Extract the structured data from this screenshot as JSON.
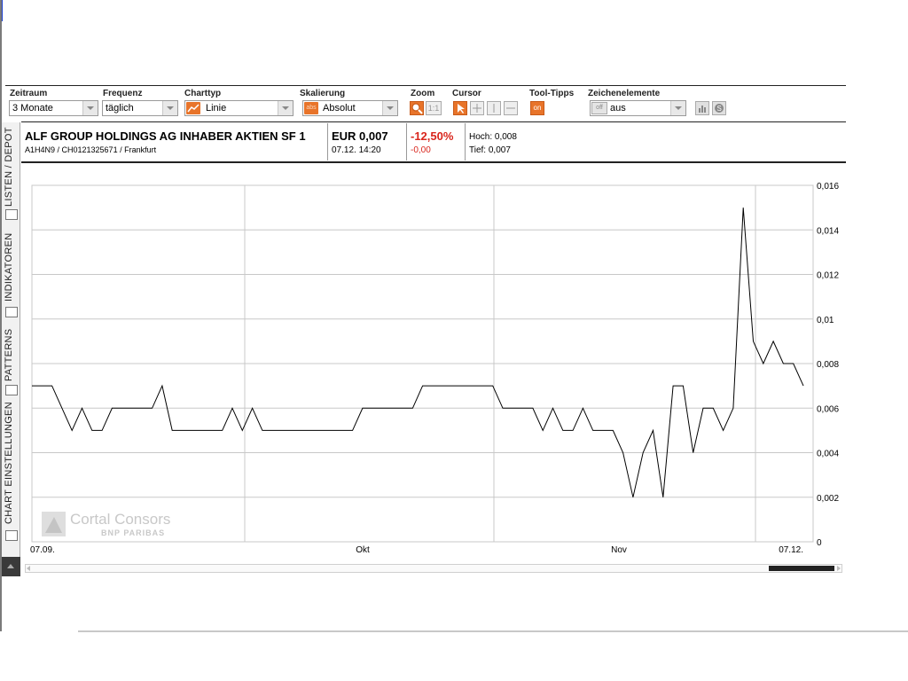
{
  "toolbar": {
    "zeitraum": {
      "label": "Zeitraum",
      "value": "3 Monate"
    },
    "frequenz": {
      "label": "Frequenz",
      "value": "täglich"
    },
    "charttyp": {
      "label": "Charttyp",
      "value": "Linie",
      "icon": "line-chart-icon"
    },
    "skalierung": {
      "label": "Skalierung",
      "value": "Absolut",
      "icon_text": "abs"
    },
    "zoom": {
      "label": "Zoom",
      "reset_label": "1:1",
      "icon": "zoom-icon"
    },
    "cursor": {
      "label": "Cursor",
      "icons": [
        "pointer-icon",
        "crosshair-icon",
        "vertical-line-icon",
        "horizontal-line-icon"
      ]
    },
    "tooltips": {
      "label": "Tool-Tipps",
      "value": "on"
    },
    "zeichenelemente": {
      "label": "Zeichenelemente",
      "value": "aus",
      "icon_text": "off"
    },
    "extra_icons": [
      "bar-chart-icon",
      "settings-icon"
    ]
  },
  "instrument": {
    "name": "ALF GROUP HOLDINGS AG INHABER AKTIEN SF 1",
    "ids": "A1H4N9 / CH0121325671 / Frankfurt",
    "price": "EUR 0,007",
    "timestamp": "07.12. 14:20",
    "change_pct": "-12,50%",
    "change_abs": "-0,00",
    "high": "Hoch: 0,008",
    "low": "Tief: 0,007"
  },
  "left_tabs": [
    "LISTEN / DEPOT",
    "INDIKATOREN",
    "PATTERNS",
    "CHART EINSTELLUNGEN"
  ],
  "watermark": {
    "line1": "Cortal Consors",
    "line2": "BNP PARIBAS"
  },
  "colors": {
    "accent": "#e8742a",
    "negative": "#d9251c",
    "line": "#000000",
    "grid": "#c8c8c8"
  },
  "chart_data": {
    "type": "line",
    "x_tick_labels": [
      "07.09.",
      "Okt",
      "Nov",
      "07.12."
    ],
    "y_tick_labels": [
      "0",
      "0,002",
      "0,004",
      "0,006",
      "0,008",
      "0,01",
      "0,012",
      "0,014",
      "0,016"
    ],
    "ylim": [
      0,
      0.016
    ],
    "y_axis_side": "right",
    "grid": true,
    "series": [
      {
        "values": [
          0.007,
          0.007,
          0.007,
          0.006,
          0.005,
          0.006,
          0.005,
          0.005,
          0.006,
          0.006,
          0.006,
          0.006,
          0.006,
          0.007,
          0.005,
          0.005,
          0.005,
          0.005,
          0.005,
          0.005,
          0.006,
          0.005,
          0.006,
          0.005,
          0.005,
          0.005,
          0.005,
          0.005,
          0.005,
          0.005,
          0.005,
          0.005,
          0.005,
          0.006,
          0.006,
          0.006,
          0.006,
          0.006,
          0.006,
          0.007,
          0.007,
          0.007,
          0.007,
          0.007,
          0.007,
          0.007,
          0.007,
          0.006,
          0.006,
          0.006,
          0.006,
          0.005,
          0.006,
          0.005,
          0.005,
          0.006,
          0.005,
          0.005,
          0.005,
          0.004,
          0.002,
          0.004,
          0.005,
          0.002,
          0.007,
          0.007,
          0.004,
          0.006,
          0.006,
          0.005,
          0.006,
          0.015,
          0.009,
          0.008,
          0.009,
          0.008,
          0.008,
          0.007
        ]
      }
    ]
  }
}
